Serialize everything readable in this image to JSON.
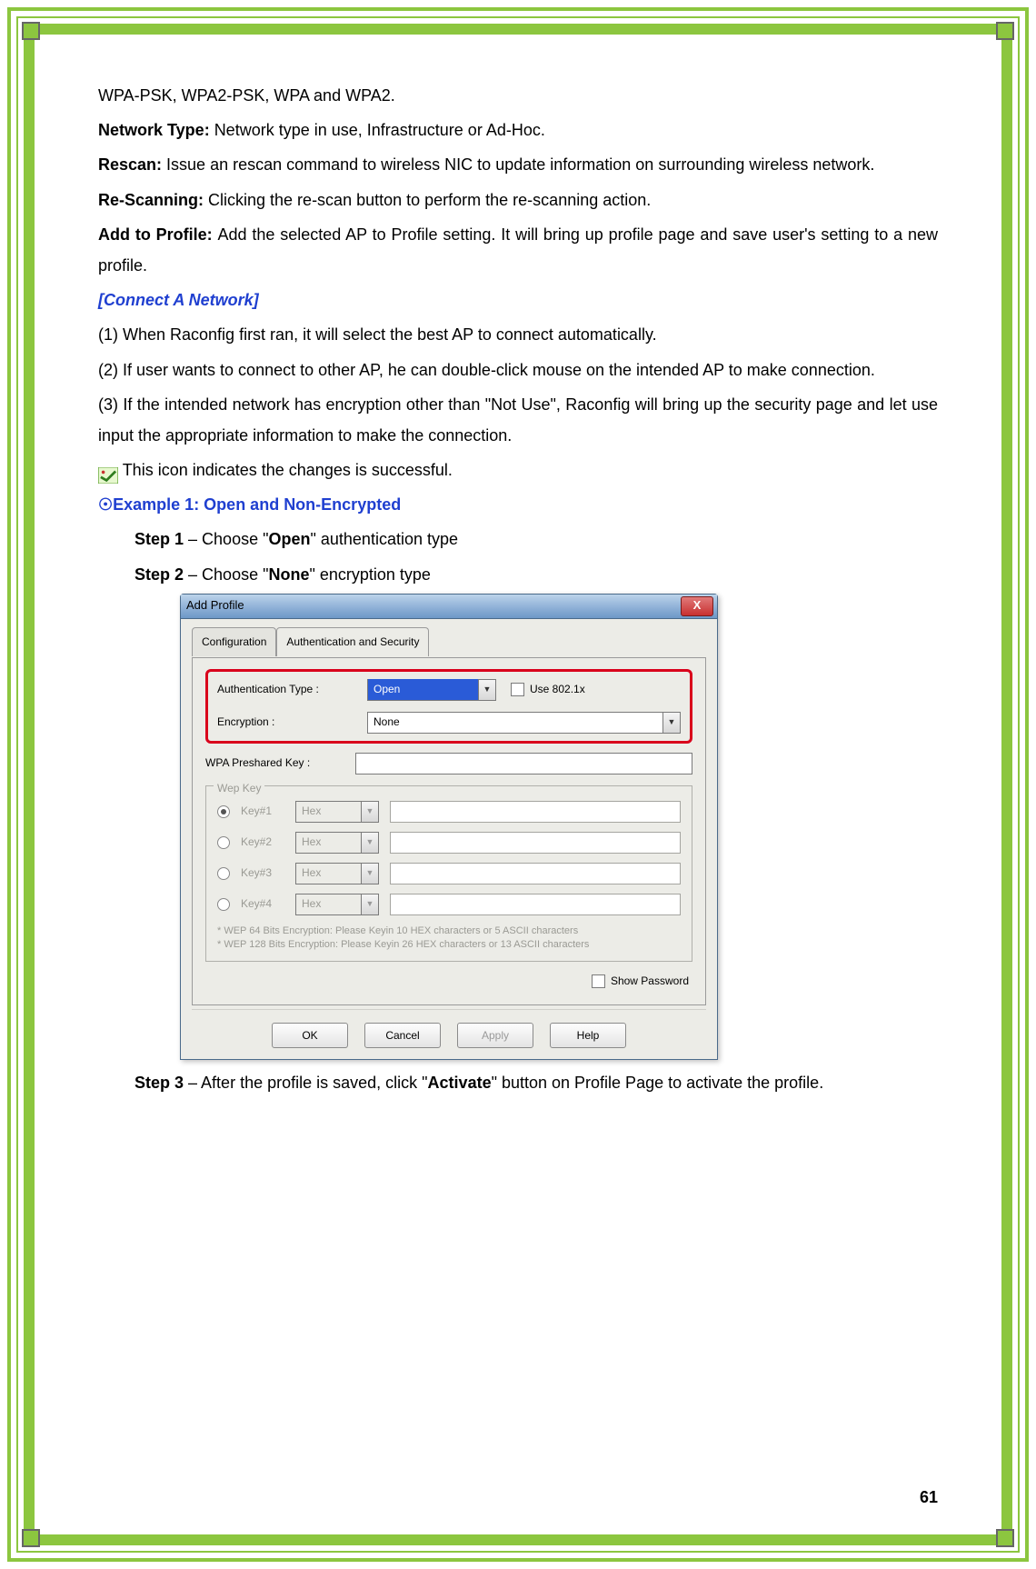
{
  "para": {
    "wpa_line": "WPA-PSK, WPA2-PSK, WPA and WPA2.",
    "network_type_label": "Network Type: ",
    "network_type_text": "Network type in use, Infrastructure or Ad-Hoc.",
    "rescan_label": "Rescan: ",
    "rescan_text": "Issue an rescan command to wireless NIC to update information on surrounding wireless network.",
    "rescanning_label": "Re-Scanning: ",
    "rescanning_text": "Clicking the re-scan button to perform the re-scanning action.",
    "addprofile_label": "Add to Profile: ",
    "addprofile_text": "Add the selected AP to Profile setting. It will bring up profile page and save user's setting to a new profile."
  },
  "connect": {
    "title": "[Connect A Network]",
    "l1": "(1) When Raconfig first ran, it will select the best AP to connect automatically.",
    "l2": "(2) If user wants to connect to other AP, he can double-click mouse on the intended AP to make connection.",
    "l3": "(3) If the intended network has encryption other than \"Not Use\", Raconfig will bring up the security page and let use input the appropriate information to make the connection.",
    "icon_note": " This icon indicates the changes is successful."
  },
  "example": {
    "title": "☉Example 1: Open and Non-Encrypted",
    "step1_pre": "Step 1",
    "step1_mid": " – Choose \"",
    "step1_bold": "Open",
    "step1_post": "\" authentication type",
    "step2_pre": "Step 2",
    "step2_mid": " – Choose \"",
    "step2_bold": "None",
    "step2_post": "\" encryption type",
    "step3_pre": "Step 3",
    "step3_mid": " – After the profile is saved, click \"",
    "step3_bold": "Activate",
    "step3_post": "\" button on Profile Page to activate the profile."
  },
  "dialog": {
    "title": "Add Profile",
    "tab1": "Configuration",
    "tab2": "Authentication and Security",
    "auth_label": "Authentication Type :",
    "auth_value": "Open",
    "use8021x": "Use 802.1x",
    "enc_label": "Encryption :",
    "enc_value": "None",
    "wpa_psk_label": "WPA Preshared Key :",
    "wep_legend": "Wep Key",
    "keys": [
      {
        "label": "Key#1",
        "fmt": "Hex"
      },
      {
        "label": "Key#2",
        "fmt": "Hex"
      },
      {
        "label": "Key#3",
        "fmt": "Hex"
      },
      {
        "label": "Key#4",
        "fmt": "Hex"
      }
    ],
    "note1": "* WEP 64 Bits Encryption:  Please Keyin 10 HEX characters or 5 ASCII characters",
    "note2": "* WEP 128 Bits Encryption:  Please Keyin 26 HEX characters or 13 ASCII characters",
    "show_password": "Show Password",
    "buttons": {
      "ok": "OK",
      "cancel": "Cancel",
      "apply": "Apply",
      "help": "Help"
    }
  },
  "page_number": "61"
}
